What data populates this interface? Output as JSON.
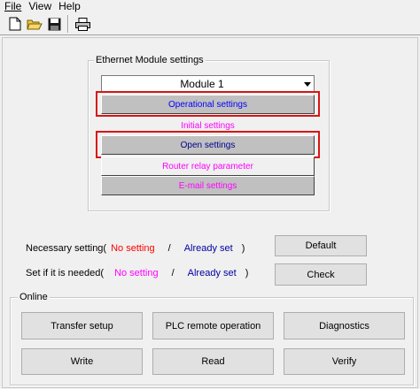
{
  "menu": {
    "file": "File",
    "view": "View",
    "help": "Help"
  },
  "toolbar": {
    "new_icon": "new-file-icon",
    "open_icon": "open-folder-icon",
    "save_icon": "save-disk-icon",
    "print_icon": "printer-icon"
  },
  "ethernet": {
    "group_label": "Ethernet Module settings",
    "module_select": "Module 1",
    "buttons": {
      "operational": "Operational settings",
      "initial": "Initial settings",
      "open": "Open settings",
      "router": "Router relay parameter",
      "email": "E-mail settings"
    }
  },
  "status": {
    "necessary_label": "Necessary setting(",
    "needed_label": "Set if it is needed(",
    "no_setting": "No setting",
    "slash": "/",
    "already_set": "Already set",
    "close": ")",
    "default_button": "Default",
    "check_button": "Check"
  },
  "online": {
    "group_label": "Online",
    "transfer_setup": "Transfer setup",
    "plc_remote": "PLC remote operation",
    "diagnostics": "Diagnostics",
    "write": "Write",
    "read": "Read",
    "verify": "Verify"
  },
  "colors": {
    "no_setting_necessary": "#ff0000",
    "no_setting_needed": "#ff00ff",
    "already_set": "#0000a0",
    "operational_text": "#0000ff",
    "open_text": "#00008b",
    "magenta_text": "#ff00ff",
    "highlight": "#d81515"
  }
}
